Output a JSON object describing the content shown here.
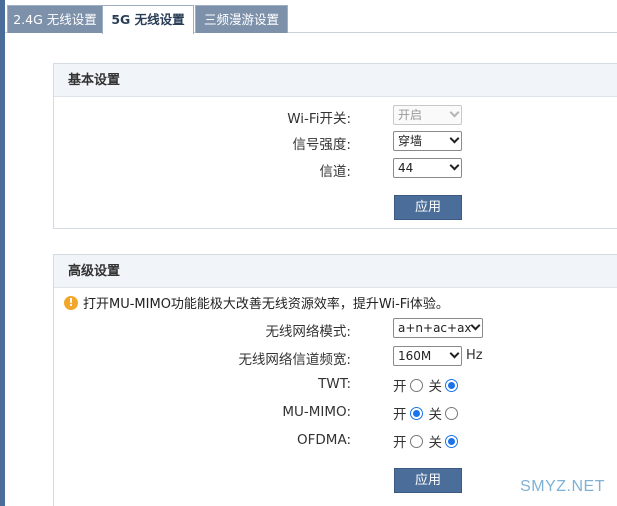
{
  "tabs": [
    {
      "label": "2.4G 无线设置",
      "active": false
    },
    {
      "label": "5G 无线设置",
      "active": true
    },
    {
      "label": "三频漫游设置",
      "active": false
    }
  ],
  "basic": {
    "title": "基本设置",
    "wifi_switch": {
      "label": "Wi-Fi开关:",
      "value": "开启"
    },
    "signal_strength": {
      "label": "信号强度:",
      "value": "穿墙"
    },
    "channel": {
      "label": "信道:",
      "value": "44"
    },
    "apply_label": "应用"
  },
  "advanced": {
    "title": "高级设置",
    "notice": "打开MU-MIMO功能能极大改善无线资源效率，提升Wi-Fi体验。",
    "wireless_mode": {
      "label": "无线网络模式:",
      "value": "a+n+ac+ax"
    },
    "bandwidth": {
      "label": "无线网络信道频宽:",
      "value": "160M",
      "unit": "Hz"
    },
    "twt": {
      "label": "TWT:",
      "on_label": "开",
      "off_label": "关",
      "selected": "off"
    },
    "mu_mimo": {
      "label": "MU-MIMO:",
      "on_label": "开",
      "off_label": "关",
      "selected": "on"
    },
    "ofdma": {
      "label": "OFDMA:",
      "on_label": "开",
      "off_label": "关",
      "selected": "off"
    },
    "apply_label": "应用"
  },
  "watermark": "SMYZ.NET",
  "colors": {
    "tab_inactive": "#7d91ab",
    "button": "#4a6d99",
    "radio_accent": "#1a73e8",
    "warning": "#f3a72a"
  }
}
